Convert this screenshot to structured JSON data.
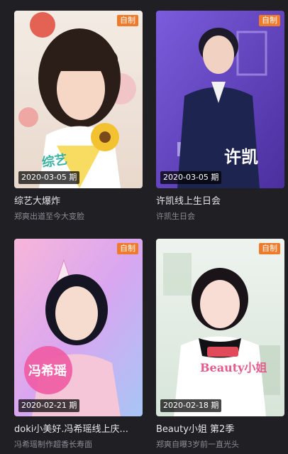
{
  "items": [
    {
      "badge": "自制",
      "date": "2020-03-05 期",
      "title": "综艺大爆炸",
      "subtitle": "郑爽出道至今大变脸",
      "accent": "#f2c230"
    },
    {
      "badge": "自制",
      "date": "2020-03-05 期",
      "title": "许凯线上生日会",
      "subtitle": "许凯生日会",
      "poster_text": "许凯",
      "accent": "#6a4fd1"
    },
    {
      "badge": "自制",
      "date": "2020-02-21 期",
      "title": "doki小美好.冯希瑶线上庆...",
      "subtitle": "冯希瑶制作超香长寿面",
      "poster_text": "冯希瑶",
      "accent": "#e06aa8"
    },
    {
      "badge": "自制",
      "date": "2020-02-18 期",
      "title": "Beauty小姐 第2季",
      "subtitle": "郑爽自曝3岁前一直光头",
      "poster_text": "Beauty小姐",
      "accent": "#d83a4a"
    }
  ]
}
